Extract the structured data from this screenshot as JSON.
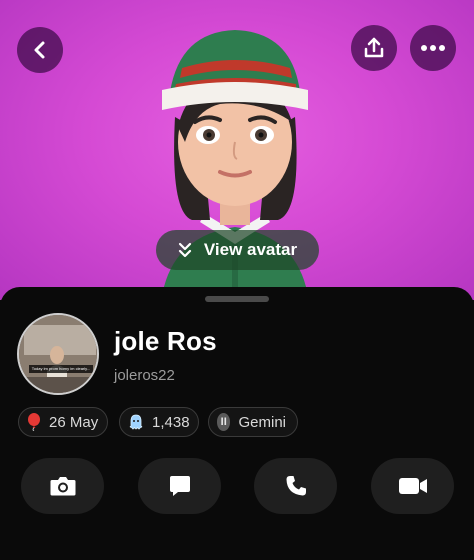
{
  "header": {
    "back_icon": "chevron-left-icon",
    "share_icon": "share-upload-icon",
    "more_icon": "more-horizontal-icon"
  },
  "avatar": {
    "view_button_label": "View avatar",
    "view_button_icon": "double-chevron-down-icon"
  },
  "profile": {
    "display_name": "jole Ros",
    "username": "joleros22",
    "photo_caption": "Today im prom horny im clearly..."
  },
  "chips": {
    "birthday": {
      "icon": "balloon-icon",
      "label": "26 May"
    },
    "score": {
      "icon": "ghost-icon",
      "label": "1,438"
    },
    "zodiac": {
      "icon": "gemini-icon",
      "glyph": "II",
      "label": "Gemini"
    }
  },
  "actions": [
    {
      "name": "camera",
      "icon": "camera-icon"
    },
    {
      "name": "chat",
      "icon": "chat-icon"
    },
    {
      "name": "call",
      "icon": "phone-icon"
    },
    {
      "name": "video",
      "icon": "video-camera-icon"
    }
  ],
  "colors": {
    "hero_background": "#d54ad4",
    "sheet_background": "#0a0a0a",
    "chip_border": "#3a3a3a",
    "action_button": "#1f1f1f",
    "elf_hat_green": "#2e7d4f",
    "elf_hat_red": "#c0392b"
  }
}
